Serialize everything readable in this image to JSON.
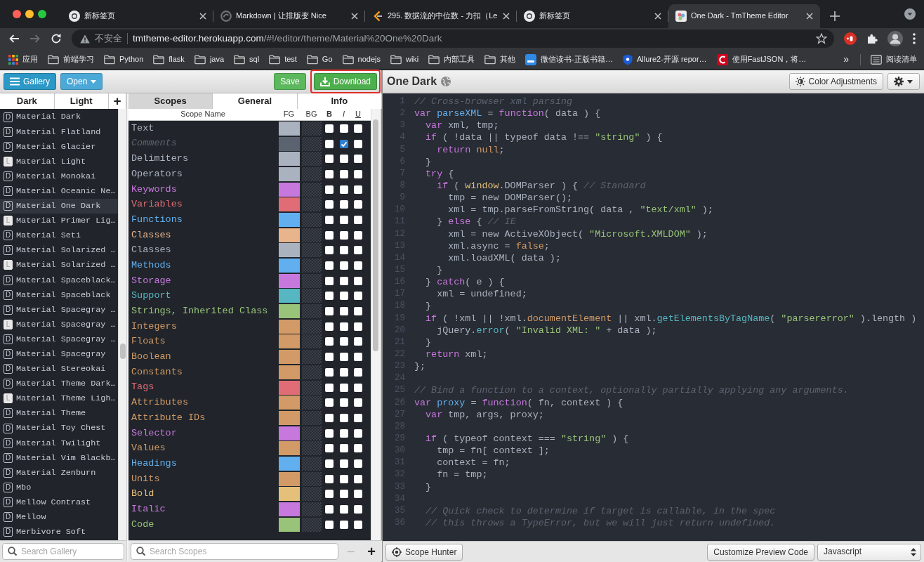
{
  "browser": {
    "tabs": [
      {
        "title": "新标签页",
        "kind": "ring",
        "selected": false
      },
      {
        "title": "Markdown | 让排版变 Nice",
        "kind": "globe",
        "selected": false
      },
      {
        "title": "295. 数据流的中位数 - 力扣（Le",
        "kind": "bracket",
        "selected": false
      },
      {
        "title": "新标签页",
        "kind": "ring",
        "selected": false
      },
      {
        "title": "One Dark - TmTheme Editor",
        "kind": "palette",
        "selected": true
      }
    ],
    "navigation": [
      {
        "kind": "back",
        "disabled": false
      },
      {
        "kind": "forward",
        "disabled": true
      },
      {
        "kind": "reload",
        "disabled": false
      }
    ],
    "address": {
      "security": "不安全",
      "host": "tmtheme-editor.herokuapp.com",
      "path": "/#!/editor/theme/Material%20One%20Dark"
    },
    "bookmarks": [
      {
        "label": "应用",
        "kind": "apps"
      },
      {
        "label": "前端学习",
        "kind": "folder"
      },
      {
        "label": "Python",
        "kind": "folder"
      },
      {
        "label": "flask",
        "kind": "folder"
      },
      {
        "label": "java",
        "kind": "folder"
      },
      {
        "label": "sql",
        "kind": "folder"
      },
      {
        "label": "test",
        "kind": "folder"
      },
      {
        "label": "Go",
        "kind": "folder"
      },
      {
        "label": "nodejs",
        "kind": "folder"
      },
      {
        "label": "wiki",
        "kind": "folder"
      },
      {
        "label": "内部工具",
        "kind": "folder"
      },
      {
        "label": "其他",
        "kind": "folder"
      },
      {
        "label": "微信读书-正版书籍…",
        "kind": "square"
      },
      {
        "label": "Allure2-开源 repor…",
        "kind": "shield"
      },
      {
        "label": "使用FastJSON，将…",
        "kind": "arc"
      }
    ],
    "more_bookmarks": "»",
    "reading_list": "阅读清单"
  },
  "toolbar": {
    "gallery": "Gallery",
    "open": "Open",
    "save": "Save",
    "download": {
      "label": "Download",
      "highlighted": true
    }
  },
  "gallery": {
    "tabs": [
      {
        "label": "Dark",
        "selected": false
      },
      {
        "label": "Light",
        "selected": false
      }
    ],
    "add": "+",
    "items": [
      {
        "name": "Material Dark",
        "badge": "D",
        "kind": "dark",
        "selected": false
      },
      {
        "name": "Material Flatland",
        "badge": "D",
        "kind": "dark",
        "selected": false
      },
      {
        "name": "Material Glacier",
        "badge": "D",
        "kind": "dark",
        "selected": false
      },
      {
        "name": "Material Light",
        "badge": "L",
        "kind": "light",
        "selected": false
      },
      {
        "name": "Material Monokai",
        "badge": "D",
        "kind": "dark",
        "selected": false
      },
      {
        "name": "Material Oceanic Ne…",
        "badge": "D",
        "kind": "dark",
        "selected": false
      },
      {
        "name": "Material One Dark",
        "badge": "D",
        "kind": "dark",
        "selected": true
      },
      {
        "name": "Material Primer Lig…",
        "badge": "L",
        "kind": "light",
        "selected": false
      },
      {
        "name": "Material Seti",
        "badge": "D",
        "kind": "dark",
        "selected": false
      },
      {
        "name": "Material Solarized …",
        "badge": "D",
        "kind": "dark",
        "selected": false
      },
      {
        "name": "Material Solarized …",
        "badge": "L",
        "kind": "light",
        "selected": false
      },
      {
        "name": "Material Spaceblack…",
        "badge": "D",
        "kind": "dark",
        "selected": false
      },
      {
        "name": "Material Spaceblack",
        "badge": "D",
        "kind": "dark",
        "selected": false
      },
      {
        "name": "Material Spacegray …",
        "badge": "D",
        "kind": "dark",
        "selected": false
      },
      {
        "name": "Material Spacegray …",
        "badge": "L",
        "kind": "light",
        "selected": false
      },
      {
        "name": "Material Spacegray …",
        "badge": "D",
        "kind": "dark",
        "selected": false
      },
      {
        "name": "Material Spacegray",
        "badge": "D",
        "kind": "dark",
        "selected": false
      },
      {
        "name": "Material Stereokai",
        "badge": "D",
        "kind": "dark",
        "selected": false
      },
      {
        "name": "Material Theme Dark…",
        "badge": "D",
        "kind": "dark",
        "selected": false
      },
      {
        "name": "Material Theme Ligh…",
        "badge": "L",
        "kind": "light",
        "selected": false
      },
      {
        "name": "Material Theme",
        "badge": "D",
        "kind": "dark",
        "selected": false
      },
      {
        "name": "Material Toy Chest",
        "badge": "D",
        "kind": "dark",
        "selected": false
      },
      {
        "name": "Material Twilight",
        "badge": "D",
        "kind": "dark",
        "selected": false
      },
      {
        "name": "Material Vim Blackb…",
        "badge": "D",
        "kind": "dark",
        "selected": false
      },
      {
        "name": "Material Zenburn",
        "badge": "D",
        "kind": "dark",
        "selected": false
      },
      {
        "name": "Mbo",
        "badge": "D",
        "kind": "dark",
        "selected": false
      },
      {
        "name": "Mellow Contrast",
        "badge": "D",
        "kind": "dark",
        "selected": false
      },
      {
        "name": "Mellow",
        "badge": "D",
        "kind": "dark",
        "selected": false
      },
      {
        "name": "Merbivore Soft",
        "badge": "D",
        "kind": "dark",
        "selected": false
      }
    ],
    "search_placeholder": "Search Gallery"
  },
  "panel_tabs": [
    {
      "label": "Scopes",
      "selected": true
    },
    {
      "label": "General",
      "selected": false
    },
    {
      "label": "Info",
      "selected": false
    }
  ],
  "scopes": {
    "columns": [
      "Scope Name",
      "FG",
      "BG",
      "B",
      "I",
      "U"
    ],
    "rows": [
      {
        "name": "Text",
        "color": "#abb2bf",
        "bold": false,
        "italic": false,
        "underline": false
      },
      {
        "name": "Comments",
        "color": "#5c6370",
        "bold": false,
        "italic": true,
        "underline": false
      },
      {
        "name": "Delimiters",
        "color": "#abb2bf",
        "bold": false,
        "italic": false,
        "underline": false
      },
      {
        "name": "Operators",
        "color": "#abb2bf",
        "bold": false,
        "italic": false,
        "underline": false
      },
      {
        "name": "Keywords",
        "color": "#c678dd",
        "bold": false,
        "italic": false,
        "underline": false
      },
      {
        "name": "Variables",
        "color": "#e06c75",
        "bold": false,
        "italic": false,
        "underline": false
      },
      {
        "name": "Functions",
        "color": "#61afef",
        "bold": false,
        "italic": false,
        "underline": false
      },
      {
        "name": "Classes",
        "color": "#e8b48c",
        "bold": false,
        "italic": false,
        "underline": false
      },
      {
        "name": "Classes",
        "color": "#abb2bf",
        "bold": false,
        "italic": false,
        "underline": false
      },
      {
        "name": "Methods",
        "color": "#61afef",
        "bold": false,
        "italic": false,
        "underline": false
      },
      {
        "name": "Storage",
        "color": "#c678dd",
        "bold": false,
        "italic": false,
        "underline": false
      },
      {
        "name": "Support",
        "color": "#56b6c2",
        "bold": false,
        "italic": false,
        "underline": false
      },
      {
        "name": "Strings, Inherited Class",
        "color": "#98c379",
        "bold": false,
        "italic": false,
        "underline": false
      },
      {
        "name": "Integers",
        "color": "#d19a66",
        "bold": false,
        "italic": false,
        "underline": false
      },
      {
        "name": "Floats",
        "color": "#d19a66",
        "bold": false,
        "italic": false,
        "underline": false
      },
      {
        "name": "Boolean",
        "color": "#d19a66",
        "bold": false,
        "italic": false,
        "underline": false
      },
      {
        "name": "Constants",
        "color": "#d19a66",
        "bold": false,
        "italic": false,
        "underline": false
      },
      {
        "name": "Tags",
        "color": "#e06c75",
        "bold": false,
        "italic": false,
        "underline": false
      },
      {
        "name": "Attributes",
        "color": "#d19a66",
        "bold": false,
        "italic": false,
        "underline": false
      },
      {
        "name": "Attribute IDs",
        "color": "#d19a66",
        "bold": false,
        "italic": false,
        "underline": false
      },
      {
        "name": "Selector",
        "color": "#c678dd",
        "bold": false,
        "italic": false,
        "underline": false
      },
      {
        "name": "Values",
        "color": "#d19a66",
        "bold": false,
        "italic": false,
        "underline": false
      },
      {
        "name": "Headings",
        "color": "#61afef",
        "bold": false,
        "italic": false,
        "underline": false
      },
      {
        "name": "Units",
        "color": "#d19a66",
        "bold": false,
        "italic": false,
        "underline": false
      },
      {
        "name": "Bold",
        "color": "#e5c07b",
        "bold": false,
        "italic": false,
        "underline": false
      },
      {
        "name": "Italic",
        "color": "#c678dd",
        "bold": false,
        "italic": false,
        "underline": false
      },
      {
        "name": "Code",
        "color": "#98c379",
        "bold": false,
        "italic": false,
        "underline": false
      }
    ],
    "search_placeholder": "Search Scopes",
    "remove": "−",
    "add": "+"
  },
  "preview": {
    "title": "One Dark",
    "color_adjustments": "Color Adjustments",
    "lines": [
      {
        "number": "1",
        "tokens": [
          {
            "kind": "comment",
            "text": "// Cross-browser xml parsing"
          }
        ]
      },
      {
        "number": "2",
        "tokens": [
          {
            "kind": "keyword",
            "text": "var "
          },
          {
            "kind": "function",
            "text": "parseXML"
          },
          {
            "kind": "plain",
            "text": " = "
          },
          {
            "kind": "keyword",
            "text": "function"
          },
          {
            "kind": "plain",
            "text": "( data ) {"
          }
        ]
      },
      {
        "number": "3",
        "tokens": [
          {
            "kind": "keyword",
            "text": "  var"
          },
          {
            "kind": "plain",
            "text": " xml, tmp;"
          }
        ]
      },
      {
        "number": "4",
        "tokens": [
          {
            "kind": "keyword",
            "text": "  if"
          },
          {
            "kind": "plain",
            "text": " ( !data || typeof data !== "
          },
          {
            "kind": "string",
            "text": "\"string\""
          },
          {
            "kind": "plain",
            "text": " ) {"
          }
        ]
      },
      {
        "number": "5",
        "tokens": [
          {
            "kind": "keyword",
            "text": "    return "
          },
          {
            "kind": "constant",
            "text": "null"
          },
          {
            "kind": "plain",
            "text": ";"
          }
        ]
      },
      {
        "number": "6",
        "tokens": [
          {
            "kind": "plain",
            "text": "  }"
          }
        ]
      },
      {
        "number": "7",
        "tokens": [
          {
            "kind": "keyword",
            "text": "  try"
          },
          {
            "kind": "plain",
            "text": " {"
          }
        ]
      },
      {
        "number": "8",
        "tokens": [
          {
            "kind": "keyword",
            "text": "    if"
          },
          {
            "kind": "plain",
            "text": " ( "
          },
          {
            "kind": "global",
            "text": "window"
          },
          {
            "kind": "plain",
            "text": ".DOMParser ) { "
          },
          {
            "kind": "comment",
            "text": "// Standard"
          }
        ]
      },
      {
        "number": "9",
        "tokens": [
          {
            "kind": "plain",
            "text": "      tmp = new DOMParser();"
          }
        ]
      },
      {
        "number": "10",
        "tokens": [
          {
            "kind": "plain",
            "text": "      xml = tmp.parseFromString( data , "
          },
          {
            "kind": "string",
            "text": "\"text/xml\""
          },
          {
            "kind": "plain",
            "text": " );"
          }
        ]
      },
      {
        "number": "11",
        "tokens": [
          {
            "kind": "plain",
            "text": "    } "
          },
          {
            "kind": "keyword",
            "text": "else"
          },
          {
            "kind": "plain",
            "text": " { "
          },
          {
            "kind": "comment",
            "text": "// IE"
          }
        ]
      },
      {
        "number": "12",
        "tokens": [
          {
            "kind": "plain",
            "text": "      xml = new ActiveXObject( "
          },
          {
            "kind": "string",
            "text": "\"Microsoft.XMLDOM\""
          },
          {
            "kind": "plain",
            "text": " );"
          }
        ]
      },
      {
        "number": "13",
        "tokens": [
          {
            "kind": "plain",
            "text": "      xml.async = "
          },
          {
            "kind": "constant",
            "text": "false"
          },
          {
            "kind": "plain",
            "text": ";"
          }
        ]
      },
      {
        "number": "14",
        "tokens": [
          {
            "kind": "plain",
            "text": "      xml.loadXML( data );"
          }
        ]
      },
      {
        "number": "15",
        "tokens": [
          {
            "kind": "plain",
            "text": "    }"
          }
        ]
      },
      {
        "number": "16",
        "tokens": [
          {
            "kind": "plain",
            "text": "  } "
          },
          {
            "kind": "keyword",
            "text": "catch"
          },
          {
            "kind": "plain",
            "text": "( e ) {"
          }
        ]
      },
      {
        "number": "17",
        "tokens": [
          {
            "kind": "plain",
            "text": "    xml = undefined;"
          }
        ]
      },
      {
        "number": "18",
        "tokens": [
          {
            "kind": "plain",
            "text": "  }"
          }
        ]
      },
      {
        "number": "19",
        "tokens": [
          {
            "kind": "keyword",
            "text": "  if"
          },
          {
            "kind": "plain",
            "text": " ( !xml || !xml."
          },
          {
            "kind": "constant",
            "text": "documentElement"
          },
          {
            "kind": "plain",
            "text": " || xml."
          },
          {
            "kind": "method",
            "text": "getElementsByTagName"
          },
          {
            "kind": "plain",
            "text": "( "
          },
          {
            "kind": "string",
            "text": "\"parsererror\""
          },
          {
            "kind": "plain",
            "text": " ).length )"
          }
        ]
      },
      {
        "number": "20",
        "tokens": [
          {
            "kind": "plain",
            "text": "    jQuery."
          },
          {
            "kind": "method",
            "text": "error"
          },
          {
            "kind": "plain",
            "text": "( "
          },
          {
            "kind": "string",
            "text": "\"Invalid XML: \""
          },
          {
            "kind": "plain",
            "text": " + data );"
          }
        ]
      },
      {
        "number": "21",
        "tokens": [
          {
            "kind": "plain",
            "text": "  }"
          }
        ]
      },
      {
        "number": "22",
        "tokens": [
          {
            "kind": "keyword",
            "text": "  return"
          },
          {
            "kind": "plain",
            "text": " xml;"
          }
        ]
      },
      {
        "number": "23",
        "tokens": [
          {
            "kind": "plain",
            "text": "};"
          }
        ]
      },
      {
        "number": "24"
      },
      {
        "number": "25",
        "tokens": [
          {
            "kind": "comment",
            "text": "// Bind a function to a context, optionally partially applying any arguments."
          }
        ]
      },
      {
        "number": "26",
        "tokens": [
          {
            "kind": "keyword",
            "text": "var "
          },
          {
            "kind": "function",
            "text": "proxy"
          },
          {
            "kind": "plain",
            "text": " = "
          },
          {
            "kind": "keyword",
            "text": "function"
          },
          {
            "kind": "plain",
            "text": "( fn, context ) {"
          }
        ]
      },
      {
        "number": "27",
        "tokens": [
          {
            "kind": "keyword",
            "text": "  var"
          },
          {
            "kind": "plain",
            "text": " tmp, args, proxy;"
          }
        ]
      },
      {
        "number": "28"
      },
      {
        "number": "29",
        "tokens": [
          {
            "kind": "keyword",
            "text": "  if"
          },
          {
            "kind": "plain",
            "text": " ( typeof context === "
          },
          {
            "kind": "string",
            "text": "\"string\""
          },
          {
            "kind": "plain",
            "text": " ) {"
          }
        ]
      },
      {
        "number": "30",
        "tokens": [
          {
            "kind": "plain",
            "text": "    tmp = fn[ context ];"
          }
        ]
      },
      {
        "number": "31",
        "tokens": [
          {
            "kind": "plain",
            "text": "    context = fn;"
          }
        ]
      },
      {
        "number": "32",
        "tokens": [
          {
            "kind": "plain",
            "text": "    fn = tmp;"
          }
        ]
      },
      {
        "number": "33",
        "tokens": [
          {
            "kind": "plain",
            "text": "  }"
          }
        ]
      },
      {
        "number": "34"
      },
      {
        "number": "35",
        "tokens": [
          {
            "kind": "comment",
            "text": "  // Quick check to determine if target is callable, in the spec"
          }
        ]
      },
      {
        "number": "36",
        "tokens": [
          {
            "kind": "comment",
            "text": "  // this throws a TypeError, but we will just return undefined."
          }
        ]
      }
    ],
    "scope_hunter": "Scope Hunter",
    "customize": "Customize Preview Code",
    "language": "Javascript"
  }
}
